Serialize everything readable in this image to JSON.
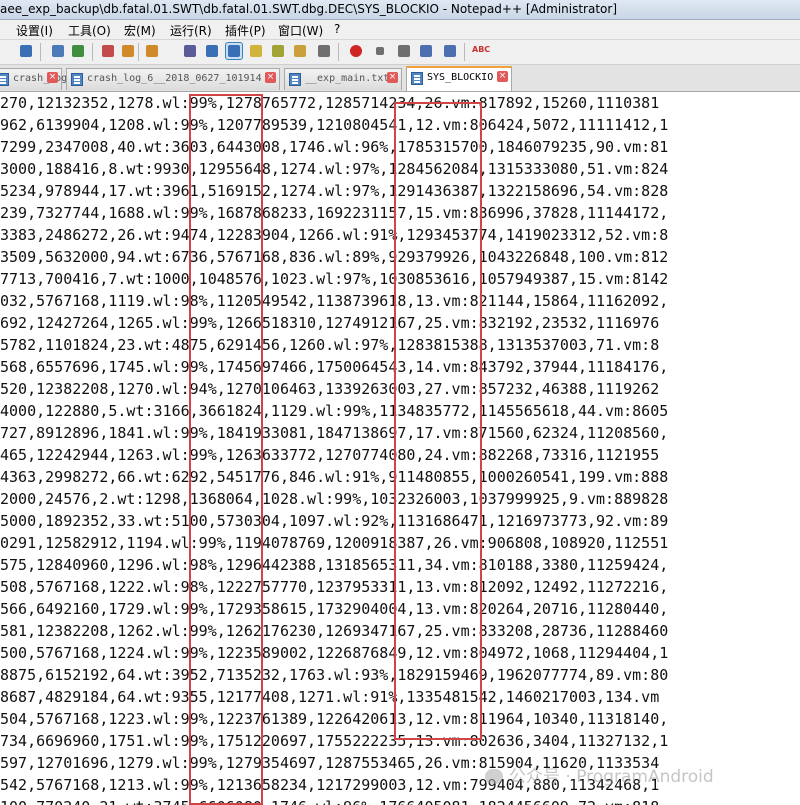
{
  "window": {
    "title": "aee_exp_backup\\db.fatal.01.SWT\\db.fatal.01.SWT.dbg.DEC\\SYS_BLOCKIO - Notepad++ [Administrator]"
  },
  "menu": [
    {
      "label": "设置(I)"
    },
    {
      "label": "工具(O)"
    },
    {
      "label": "宏(M)"
    },
    {
      "label": "运行(R)"
    },
    {
      "label": "插件(P)"
    },
    {
      "label": "窗口(W)"
    },
    {
      "label": "?"
    }
  ],
  "toolbar": [
    {
      "icon": "cut-icon",
      "color": "#3a6fb5"
    },
    {
      "icon": "copy-icon",
      "color": "#4a7ab8"
    },
    {
      "icon": "find-icon",
      "color": "#3f8f3f"
    },
    {
      "icon": "replace-icon",
      "color": "#c24b4b"
    },
    {
      "icon": "zoom-in-icon",
      "color": "#d08a2a"
    },
    {
      "icon": "zoom-out-icon",
      "color": "#d08a2a"
    },
    {
      "icon": "word-wrap-icon",
      "color": "#5b5b9a"
    },
    {
      "icon": "pilcrow-icon",
      "color": "#3a6fb5"
    },
    {
      "icon": "indent-guide-icon",
      "color": "#3a6fb5"
    },
    {
      "icon": "doc-map-icon",
      "color": "#d2b33a"
    },
    {
      "icon": "function-list-icon",
      "color": "#a3a335"
    },
    {
      "icon": "folder-icon",
      "color": "#c9a03c"
    },
    {
      "icon": "monitor-icon",
      "color": "#6f6f6f"
    },
    {
      "icon": "record-macro-icon",
      "color": "#d02525"
    },
    {
      "icon": "stop-macro-icon",
      "color": "#6f6f6f"
    },
    {
      "icon": "play-macro-icon",
      "color": "#6f6f6f"
    },
    {
      "icon": "run-macro-icon",
      "color": "#4d6fb0"
    },
    {
      "icon": "save-macro-icon",
      "color": "#4d6fb0"
    },
    {
      "icon": "spell-check-icon",
      "color": "#c8302e"
    }
  ],
  "tabs": [
    {
      "label": "crash_log"
    },
    {
      "label": "crash_log_6__2018_0627_101914"
    },
    {
      "label": "__exp_main.txt"
    },
    {
      "label": "SYS_BLOCKIO"
    }
  ],
  "lines": [
    "270,12132352,1278.wl:99%,1278765772,1285714234,26.vm:817892,15260,1110381",
    "962,6139904,1208.wl:99%,1207789539,1210804541,12.vm:806424,5072,11111412,1",
    "7299,2347008,40.wt:3603,6443008,1746.wl:96%,1785315700,1846079235,90.vm:81",
    "3000,188416,8.wt:9930,12955648,1274.wl:97%,1284562084,1315333080,51.vm:824",
    "5234,978944,17.wt:3961,5169152,1274.wl:97%,1291436387,1322158696,54.vm:828",
    "239,7327744,1688.wl:99%,1687868233,1692231157,15.vm:836996,37828,11144172,",
    "3383,2486272,26.wt:9474,12283904,1266.wl:91%,1293453774,1419023312,52.vm:8",
    "3509,5632000,94.wt:6736,5767168,836.wl:89%,929379926,1043226848,100.vm:812",
    "7713,700416,7.wt:1000,1048576,1023.wl:97%,1030853616,1057949387,15.vm:8142",
    "032,5767168,1119.wl:98%,1120549542,1138739618,13.vm:821144,15864,11162092,",
    "692,12427264,1265.wl:99%,1266518310,1274912167,25.vm:832192,23532,1116976",
    "5782,1101824,23.wt:4875,6291456,1260.wl:97%,1283815388,1313537003,71.vm:8",
    "568,6557696,1745.wl:99%,1745697466,1750064543,14.vm:843792,37944,11184176,",
    "520,12382208,1270.wl:94%,1270106463,1339263003,27.vm:857232,46388,1119262",
    "4000,122880,5.wt:3166,3661824,1129.wl:99%,1134835772,1145565618,44.vm:8605",
    "727,8912896,1841.wl:99%,1841933081,1847138697,17.vm:871560,62324,11208560,",
    "465,12242944,1263.wl:99%,1263633772,1270774080,24.vm:882268,73316,1121955",
    "4363,2998272,66.wt:6292,5451776,846.wl:91%,911480855,1000260541,199.vm:888",
    "2000,24576,2.wt:1298,1368064,1028.wl:99%,1032326003,1037999925,9.vm:889828",
    "5000,1892352,33.wt:5100,5730304,1097.wl:92%,1131686471,1216973773,92.vm:89",
    "0291,12582912,1194.wl:99%,1194078769,1200918387,26.vm:906808,108920,112551",
    "575,12840960,1296.wl:98%,1296442388,1318565311,34.vm:810188,3380,11259424,",
    "508,5767168,1222.wl:98%,1222757770,1237953311,13.vm:812092,12492,11272216,",
    "566,6492160,1729.wl:99%,1729358615,1732904004,13.vm:820264,20716,11280440,",
    "581,12382208,1262.wl:99%,1262176230,1269347167,25.vm:833208,28736,11288460",
    "500,5767168,1224.wl:99%,1223589002,1226876849,12.vm:804972,1068,11294404,1",
    "8875,6152192,64.wt:3952,7135232,1763.wl:93%,1829159469,1962077774,89.vm:80",
    "8687,4829184,64.wt:9355,12177408,1271.wl:91%,1335481542,1460217003,134.vm",
    "504,5767168,1223.wl:99%,1223761389,1226420613,12.vm:811964,10340,11318140,",
    "734,6696960,1751.wl:99%,1751220697,1755222235,13.vm:802636,3404,11327132,1",
    "597,12701696,1279.wl:99%,1279354697,1287553465,26.vm:815904,11620,1133534",
    "542,5767168,1213.wl:99%,1213658234,1217299003,12.vm:799404,880,11342468,1",
    "100,770240,21.wt:3745,6606080,1746.wl:96%,1766405081,1824456609,72.vm:818"
  ],
  "watermark": "公众号 · ProgramAndroid"
}
